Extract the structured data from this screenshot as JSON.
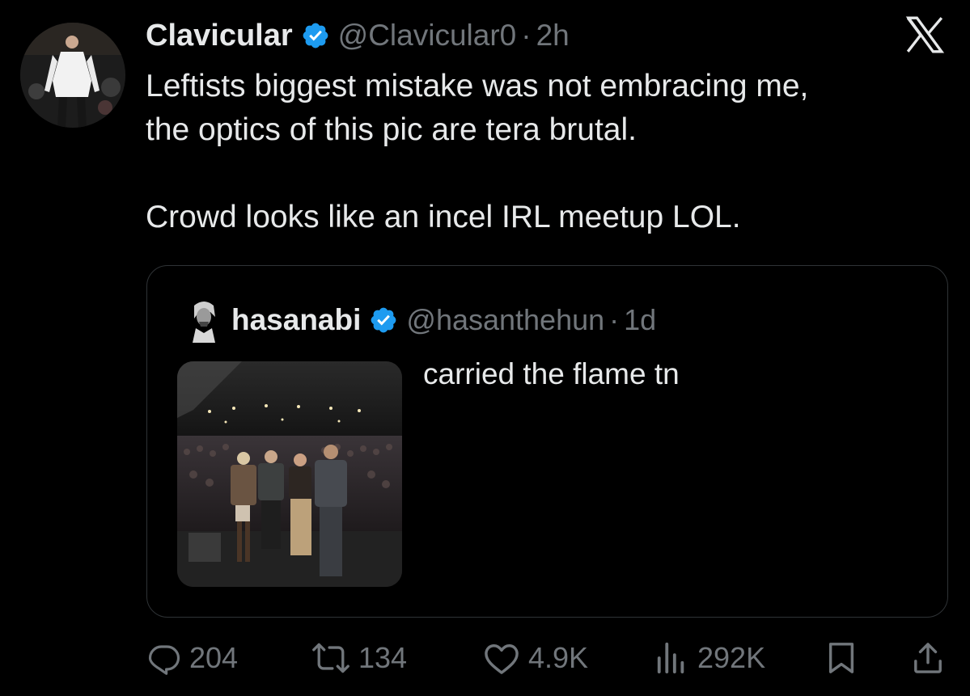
{
  "tweet": {
    "author": {
      "name": "Clavicular",
      "handle": "@Clavicular0",
      "separator": "·",
      "time": "2h",
      "verified": true,
      "avatar_icon": "avatar-man-white-jacket"
    },
    "text": [
      "Leftists biggest mistake was not embracing me,",
      "the optics of this pic are tera brutal.",
      "",
      "Crowd looks like an incel IRL meetup LOL."
    ],
    "close_icon": "x-logo-icon"
  },
  "quote": {
    "author": {
      "name": "hasanabi",
      "handle": "@hasanthehun",
      "separator": "·",
      "time": "1d",
      "verified": true,
      "avatar_icon": "avatar-portrait-bw"
    },
    "text": "carried the flame tn",
    "image_icon": "photo-stage-crowd"
  },
  "actions": {
    "replies": {
      "icon": "reply-icon",
      "count": "204"
    },
    "reposts": {
      "icon": "repost-icon",
      "count": "134"
    },
    "likes": {
      "icon": "like-icon",
      "count": "4.9K"
    },
    "views": {
      "icon": "views-icon",
      "count": "292K"
    },
    "bookmark": {
      "icon": "bookmark-icon"
    },
    "share": {
      "icon": "share-icon"
    }
  },
  "colors": {
    "background": "#000000",
    "text_primary": "#e7e9ea",
    "text_secondary": "#71767b",
    "verified_blue": "#1d9bf0",
    "border": "#2f3336"
  }
}
